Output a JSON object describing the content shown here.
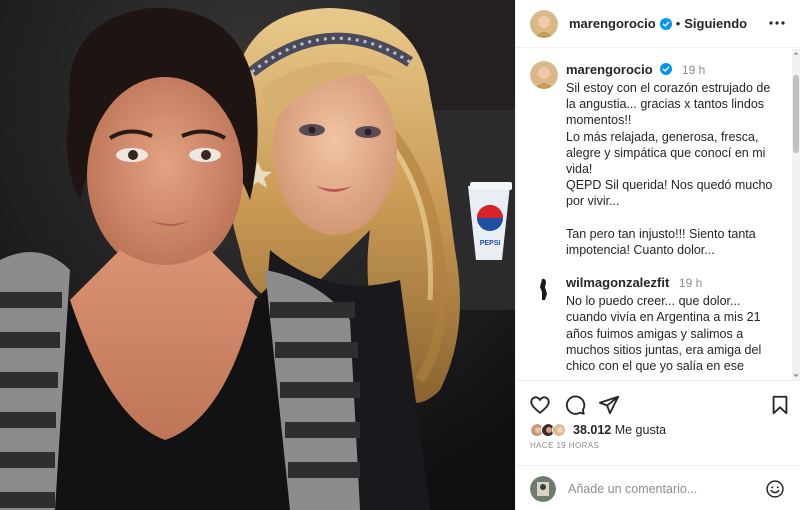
{
  "post": {
    "username": "marengorocio",
    "follow_label": "Siguiendo",
    "separator": "•"
  },
  "comments": [
    {
      "username": "marengorocio",
      "time": "19 h",
      "text": "Sil estoy con el corazón estrujado de la angustia... gracias x tantos lindos momentos!!\nLo más relajada, generosa, fresca, alegre y simpática que conocí en mi vida!\nQEPD Sil querida! Nos quedó mucho por vivir...\n\nTan pero tan injusto!!! Siento tanta impotencia! Cuanto dolor..."
    },
    {
      "username": "wilmagonzalezfit",
      "time": "19 h",
      "text": "No lo puedo creer... que dolor... cuando vivía en Argentina a mis 21 años fuimos amigas y salimos a muchos sitios juntas, era amiga del chico con el que yo salía en ese"
    }
  ],
  "likes": {
    "count": "38.012",
    "label": "Me gusta"
  },
  "posted_ago": "HACE 19 HORAS",
  "add_comment": {
    "placeholder": "Añade un comentario..."
  },
  "photo": {
    "cup_brand": "PEPSI"
  },
  "icons": {
    "verified": "verified-badge-icon",
    "more": "more-options-icon",
    "like": "heart-icon",
    "comment": "comment-bubble-icon",
    "share": "paper-plane-icon",
    "save": "bookmark-icon",
    "emoji": "smiley-icon"
  },
  "colors": {
    "verified_blue": "#0095f6",
    "muted": "#8e8e8e",
    "text": "#262626"
  }
}
